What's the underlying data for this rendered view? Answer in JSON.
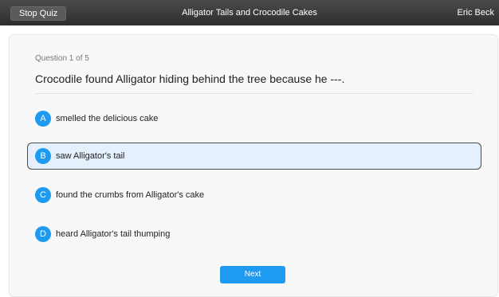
{
  "header": {
    "stop_label": "Stop Quiz",
    "title": "Alligator Tails and Crocodile Cakes",
    "user": "Eric Beck"
  },
  "question": {
    "counter": "Question 1 of 5",
    "text": "Crocodile found Alligator hiding behind the tree because he ---."
  },
  "answers": [
    {
      "letter": "A",
      "text": "smelled the delicious cake",
      "selected": false
    },
    {
      "letter": "B",
      "text": "saw Alligator's tail",
      "selected": true
    },
    {
      "letter": "C",
      "text": "found the crumbs from Alligator's cake",
      "selected": false
    },
    {
      "letter": "D",
      "text": "heard Alligator's tail thumping",
      "selected": false
    }
  ],
  "footer": {
    "next_label": "Next"
  },
  "colors": {
    "accent": "#1e9bf0",
    "selected_bg": "#e4f0fc",
    "topbar": "#3a3a3a"
  }
}
